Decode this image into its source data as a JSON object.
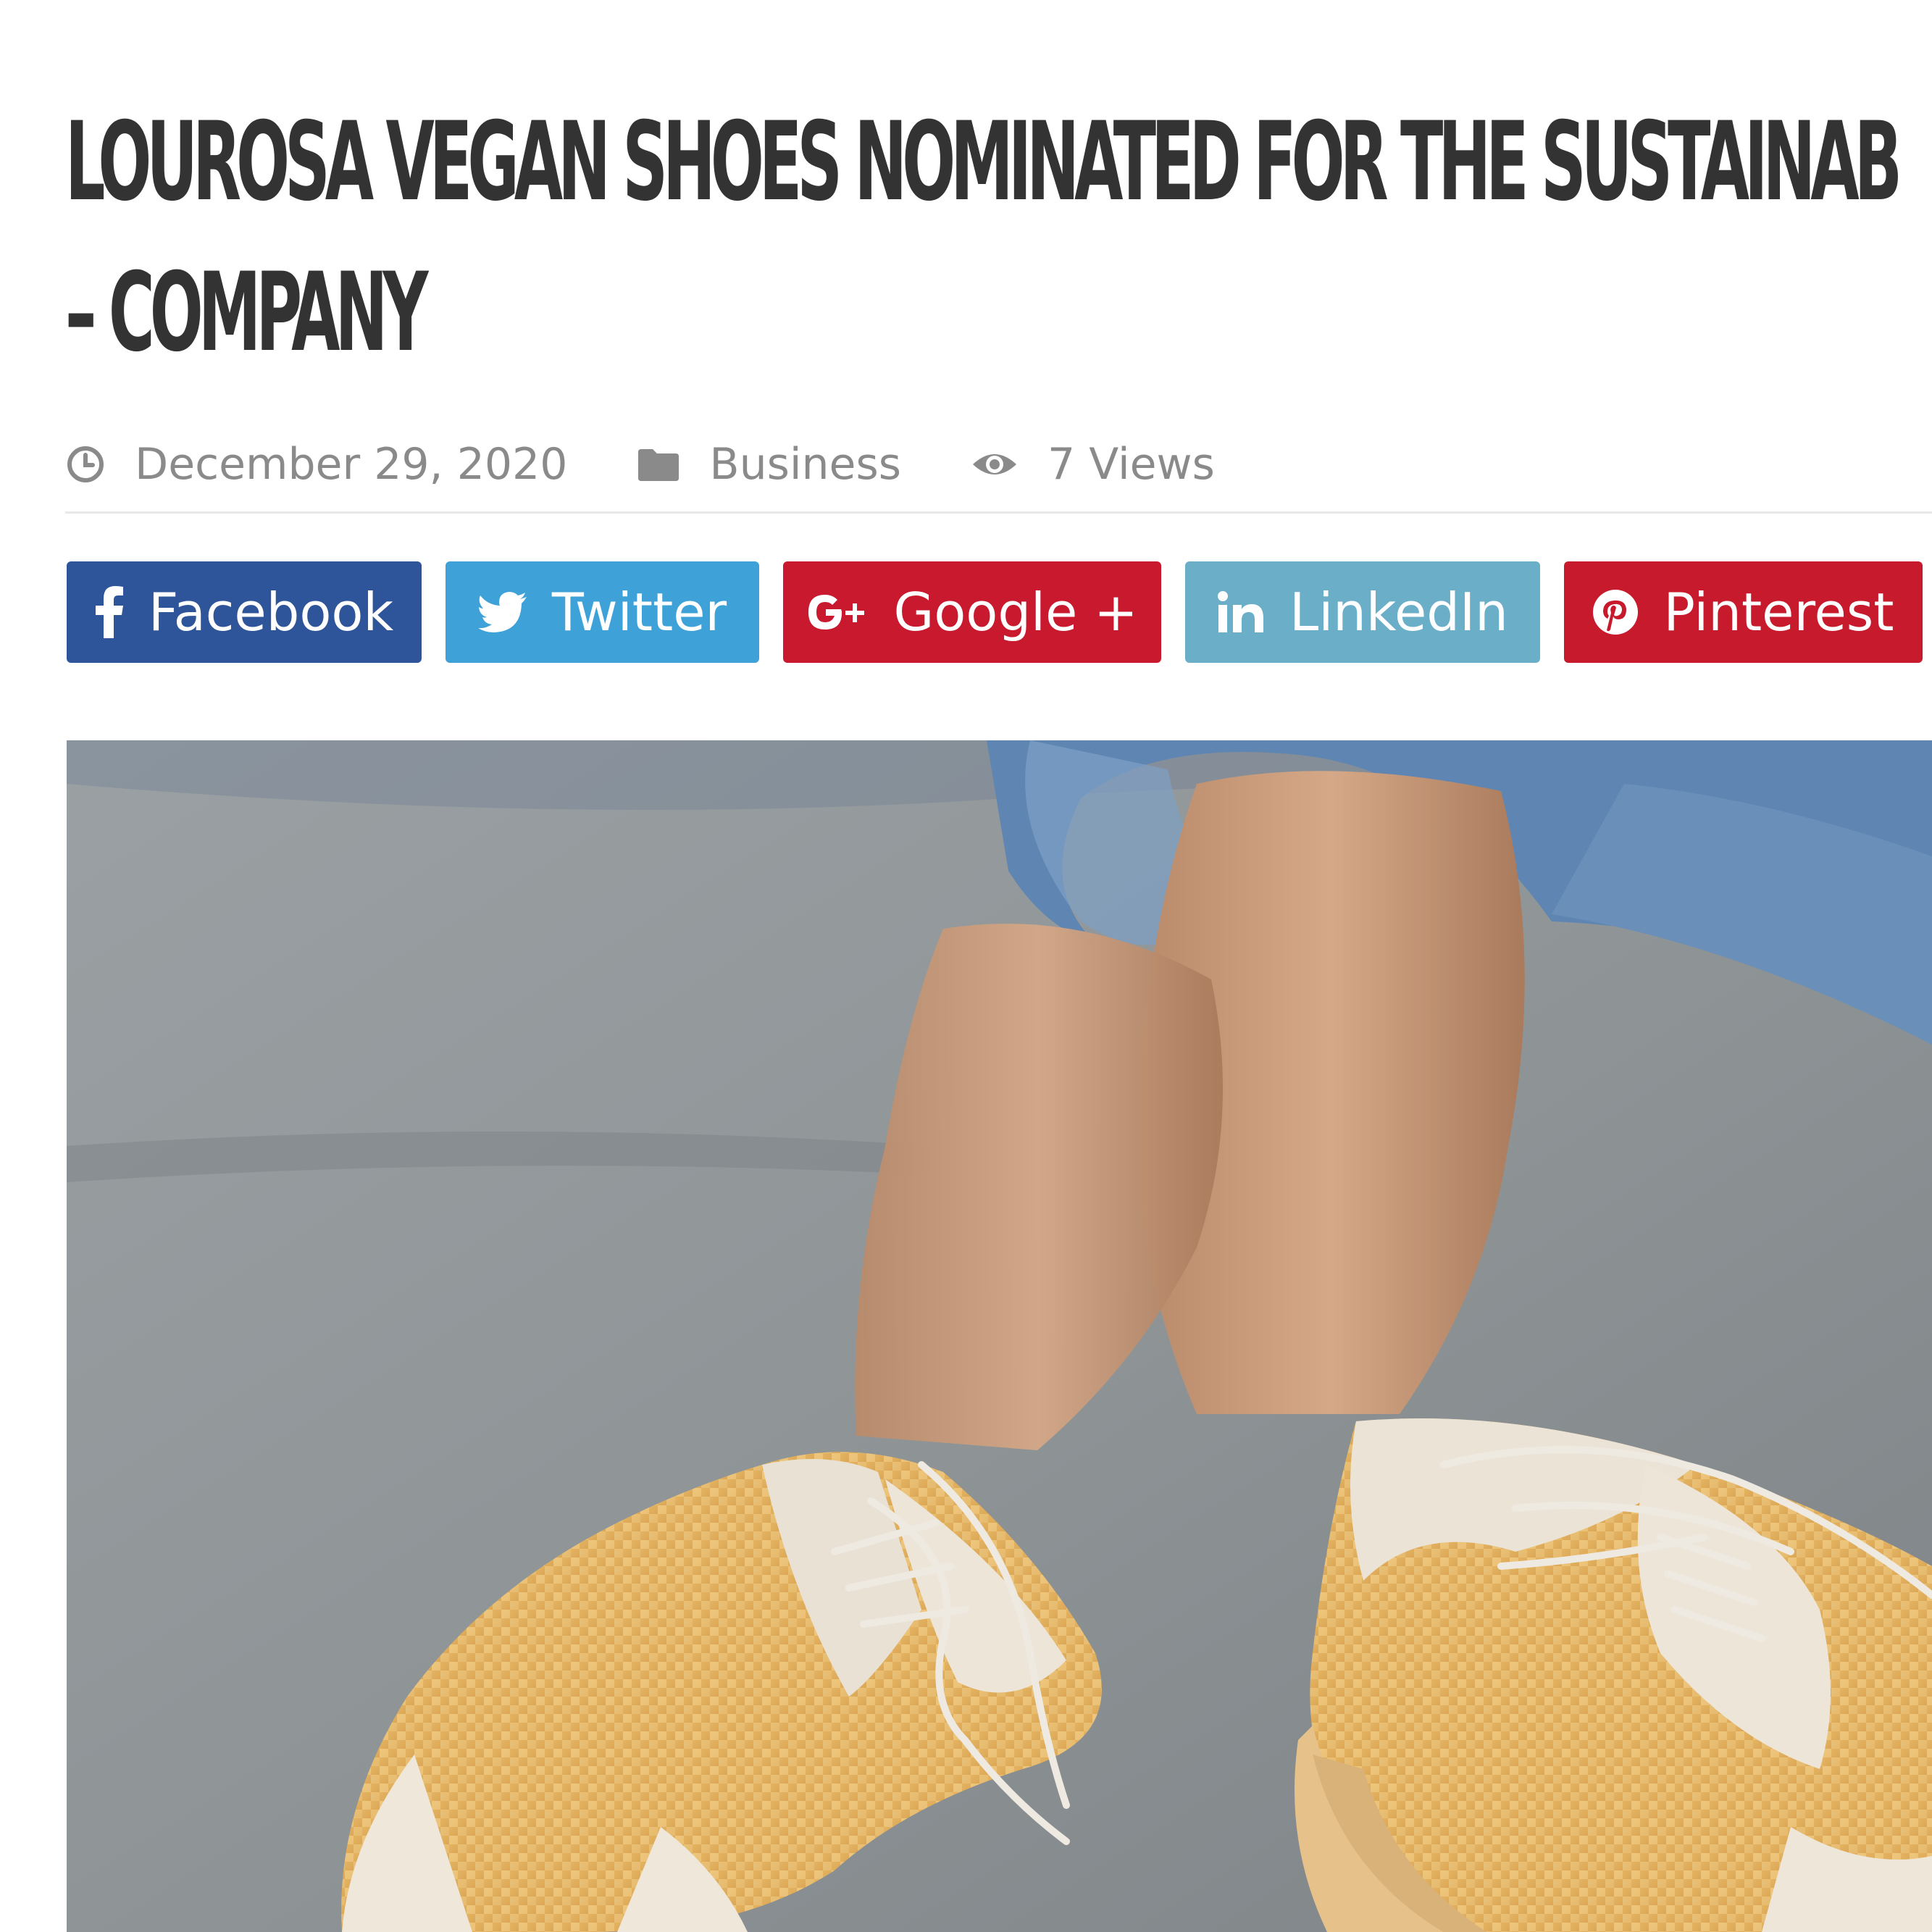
{
  "article": {
    "title_line1": "LOUROSA VEGAN SHOES NOMINATED FOR THE SUSTAINAB",
    "title_line2": "– COMPANY"
  },
  "meta": {
    "date": "December 29, 2020",
    "date_icon": "clock-icon",
    "category": "Business",
    "category_icon": "folder-icon",
    "views": "7 Views",
    "views_icon": "eye-icon"
  },
  "share": {
    "facebook": {
      "label": "Facebook",
      "icon": "facebook-icon",
      "color": "#2e5499"
    },
    "twitter": {
      "label": "Twitter",
      "icon": "twitter-icon",
      "color": "#3ea2d8"
    },
    "google": {
      "label": "Google +",
      "icon": "google-plus-icon",
      "color": "#c8192e"
    },
    "linkedin": {
      "label": "LinkedIn",
      "icon": "linkedin-icon",
      "color": "#6aaec8"
    },
    "pinterest": {
      "label": "Pinterest",
      "icon": "pinterest-icon",
      "color": "#c71a2c"
    }
  }
}
